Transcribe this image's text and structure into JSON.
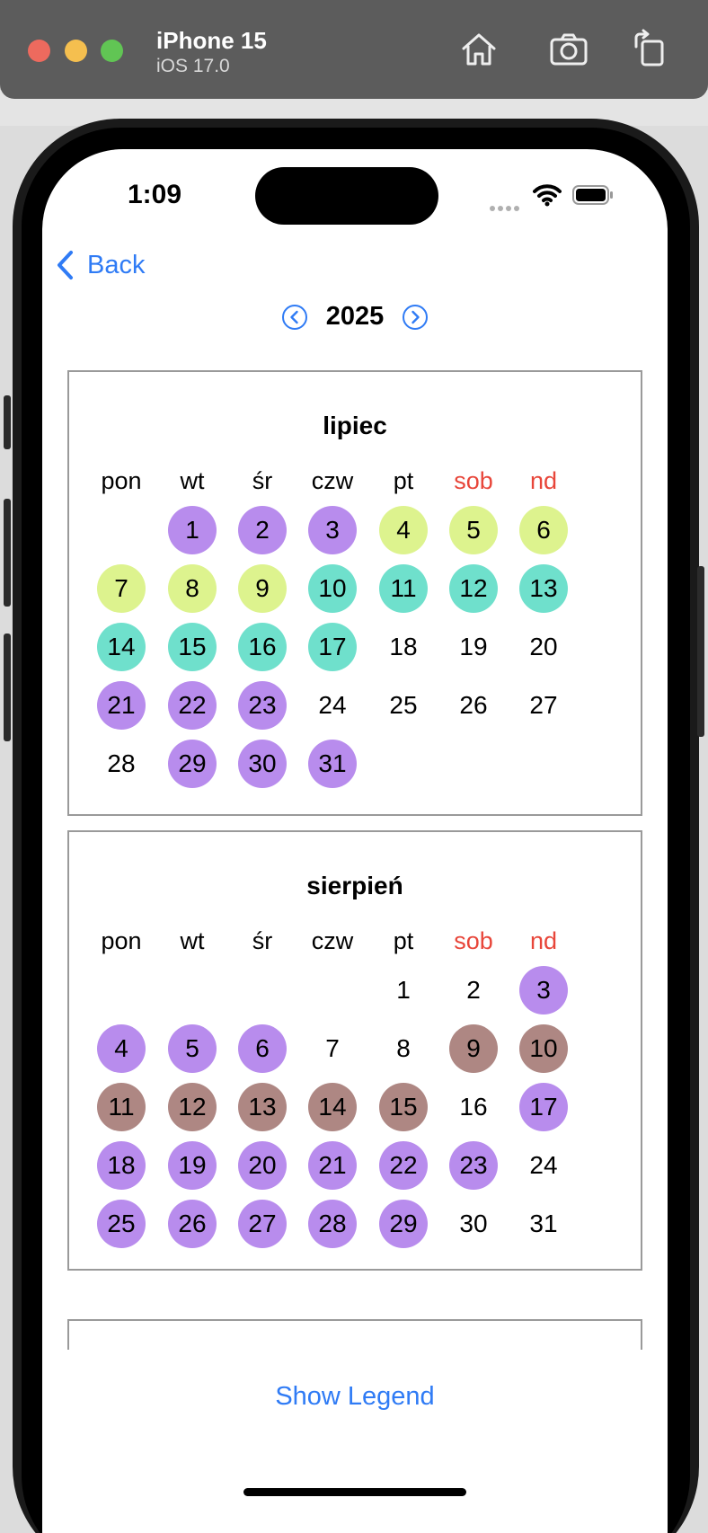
{
  "simulator": {
    "device_name": "iPhone 15",
    "os_version": "iOS 17.0"
  },
  "status_bar": {
    "time": "1:09"
  },
  "nav": {
    "back_label": "Back"
  },
  "year": "2025",
  "weekdays": [
    "pon",
    "wt",
    "śr",
    "czw",
    "pt",
    "sob",
    "nd"
  ],
  "colors": {
    "accent": "#2f7bf5",
    "weekend": "#e8463a",
    "purple": "#b88ced",
    "lime": "#ddf38e",
    "teal": "#6fe0cc",
    "brown": "#ae8783"
  },
  "months": [
    {
      "name": "lipiec",
      "first_weekday_index": 1,
      "days": [
        {
          "d": "1",
          "c": "purple"
        },
        {
          "d": "2",
          "c": "purple"
        },
        {
          "d": "3",
          "c": "purple"
        },
        {
          "d": "4",
          "c": "lime"
        },
        {
          "d": "5",
          "c": "lime"
        },
        {
          "d": "6",
          "c": "lime"
        },
        {
          "d": "7",
          "c": "lime"
        },
        {
          "d": "8",
          "c": "lime"
        },
        {
          "d": "9",
          "c": "lime"
        },
        {
          "d": "10",
          "c": "teal"
        },
        {
          "d": "11",
          "c": "teal"
        },
        {
          "d": "12",
          "c": "teal"
        },
        {
          "d": "13",
          "c": "teal"
        },
        {
          "d": "14",
          "c": "teal"
        },
        {
          "d": "15",
          "c": "teal"
        },
        {
          "d": "16",
          "c": "teal"
        },
        {
          "d": "17",
          "c": "teal"
        },
        {
          "d": "18",
          "c": ""
        },
        {
          "d": "19",
          "c": ""
        },
        {
          "d": "20",
          "c": ""
        },
        {
          "d": "21",
          "c": "purple"
        },
        {
          "d": "22",
          "c": "purple"
        },
        {
          "d": "23",
          "c": "purple"
        },
        {
          "d": "24",
          "c": ""
        },
        {
          "d": "25",
          "c": ""
        },
        {
          "d": "26",
          "c": ""
        },
        {
          "d": "27",
          "c": ""
        },
        {
          "d": "28",
          "c": ""
        },
        {
          "d": "29",
          "c": "purple"
        },
        {
          "d": "30",
          "c": "purple"
        },
        {
          "d": "31",
          "c": "purple"
        }
      ]
    },
    {
      "name": "sierpień",
      "first_weekday_index": 4,
      "days": [
        {
          "d": "1",
          "c": ""
        },
        {
          "d": "2",
          "c": ""
        },
        {
          "d": "3",
          "c": "purple"
        },
        {
          "d": "4",
          "c": "purple"
        },
        {
          "d": "5",
          "c": "purple"
        },
        {
          "d": "6",
          "c": "purple"
        },
        {
          "d": "7",
          "c": ""
        },
        {
          "d": "8",
          "c": ""
        },
        {
          "d": "9",
          "c": "brown"
        },
        {
          "d": "10",
          "c": "brown"
        },
        {
          "d": "11",
          "c": "brown"
        },
        {
          "d": "12",
          "c": "brown"
        },
        {
          "d": "13",
          "c": "brown"
        },
        {
          "d": "14",
          "c": "brown"
        },
        {
          "d": "15",
          "c": "brown"
        },
        {
          "d": "16",
          "c": ""
        },
        {
          "d": "17",
          "c": "purple"
        },
        {
          "d": "18",
          "c": "purple"
        },
        {
          "d": "19",
          "c": "purple"
        },
        {
          "d": "20",
          "c": "purple"
        },
        {
          "d": "21",
          "c": "purple"
        },
        {
          "d": "22",
          "c": "purple"
        },
        {
          "d": "23",
          "c": "purple"
        },
        {
          "d": "24",
          "c": ""
        },
        {
          "d": "25",
          "c": "purple"
        },
        {
          "d": "26",
          "c": "purple"
        },
        {
          "d": "27",
          "c": "purple"
        },
        {
          "d": "28",
          "c": "purple"
        },
        {
          "d": "29",
          "c": "purple"
        },
        {
          "d": "30",
          "c": ""
        },
        {
          "d": "31",
          "c": ""
        }
      ]
    }
  ],
  "footer": {
    "legend_button": "Show Legend"
  }
}
